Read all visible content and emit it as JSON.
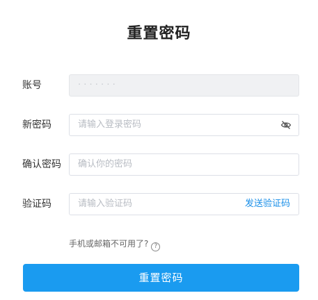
{
  "title": "重置密码",
  "form": {
    "account": {
      "label": "账号",
      "value": "· · · · · · ·"
    },
    "new_password": {
      "label": "新密码",
      "placeholder": "请输入登录密码"
    },
    "confirm_password": {
      "label": "确认密码",
      "placeholder": "确认你的密码"
    },
    "verification_code": {
      "label": "验证码",
      "placeholder": "请输入验证码",
      "send_label": "发送验证码"
    }
  },
  "help_link": "手机或邮箱不可用了?",
  "help_icon_glyph": "?",
  "submit_label": "重置密码",
  "colors": {
    "primary": "#1a9bf0",
    "link": "#1a8fe8",
    "readonly_bg": "#f0f1f3"
  },
  "icons": {
    "password_toggle": "eye-slash-icon",
    "help": "question-circle-icon"
  }
}
